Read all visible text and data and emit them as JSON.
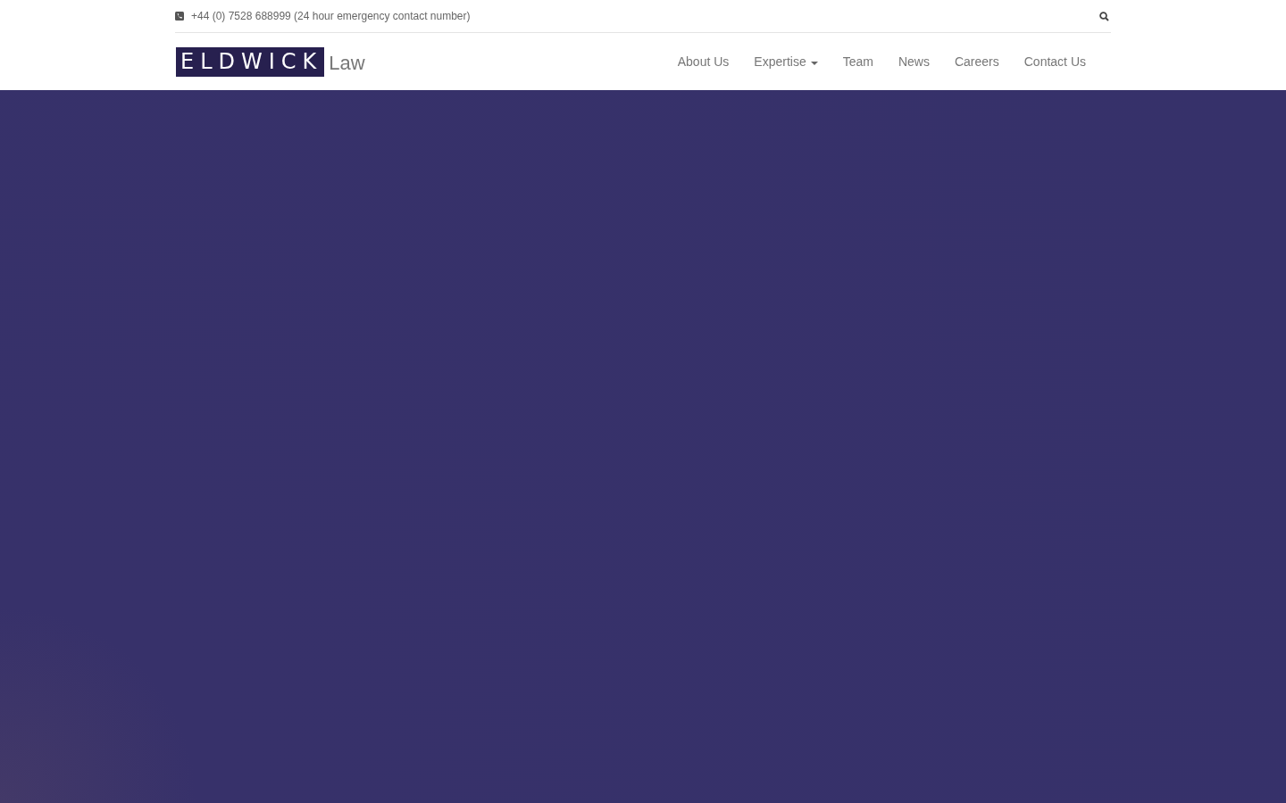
{
  "top_bar": {
    "phone": "+44 (0) 7528 688999 (24 hour emergency contact number)"
  },
  "logo": {
    "mark": "ELDWICK",
    "suffix": "Law"
  },
  "nav": [
    {
      "label": "About Us",
      "kind": "link"
    },
    {
      "label": "Expertise",
      "kind": "dropdown"
    },
    {
      "label": "Team",
      "kind": "link"
    },
    {
      "label": "News",
      "kind": "link"
    },
    {
      "label": "Careers",
      "kind": "link"
    },
    {
      "label": "Contact Us",
      "kind": "link"
    }
  ]
}
